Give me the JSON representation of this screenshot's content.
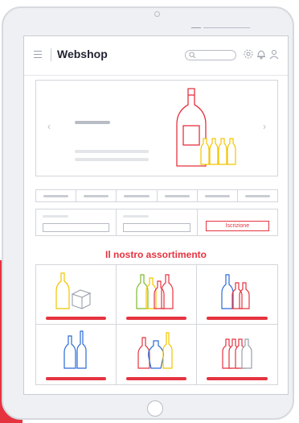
{
  "header": {
    "brand": "Webshop",
    "icons": [
      "menu-icon",
      "search-icon",
      "settings-icon",
      "bell-icon",
      "user-icon"
    ]
  },
  "hero": {
    "prev_icon": "‹",
    "next_icon": "›"
  },
  "signup": {
    "button_label": "Iscrizione"
  },
  "assortment": {
    "title": "Il nostro assortimento",
    "categories": [
      {
        "icon": "bottle-and-box-icon",
        "color": "#f2c500"
      },
      {
        "icon": "colorful-bottles-icon",
        "color": "#e53340"
      },
      {
        "icon": "blue-red-bottles-icon",
        "color": "#2a6ad6"
      },
      {
        "icon": "blue-bottles-icon",
        "color": "#2a6ad6"
      },
      {
        "icon": "mixed-bottles-icon",
        "color": "#f2c500"
      },
      {
        "icon": "wine-bottles-icon",
        "color": "#e53340"
      }
    ]
  },
  "colors": {
    "accent": "#e53340",
    "frame": "#eef0f3",
    "line": "#d3d6db"
  }
}
